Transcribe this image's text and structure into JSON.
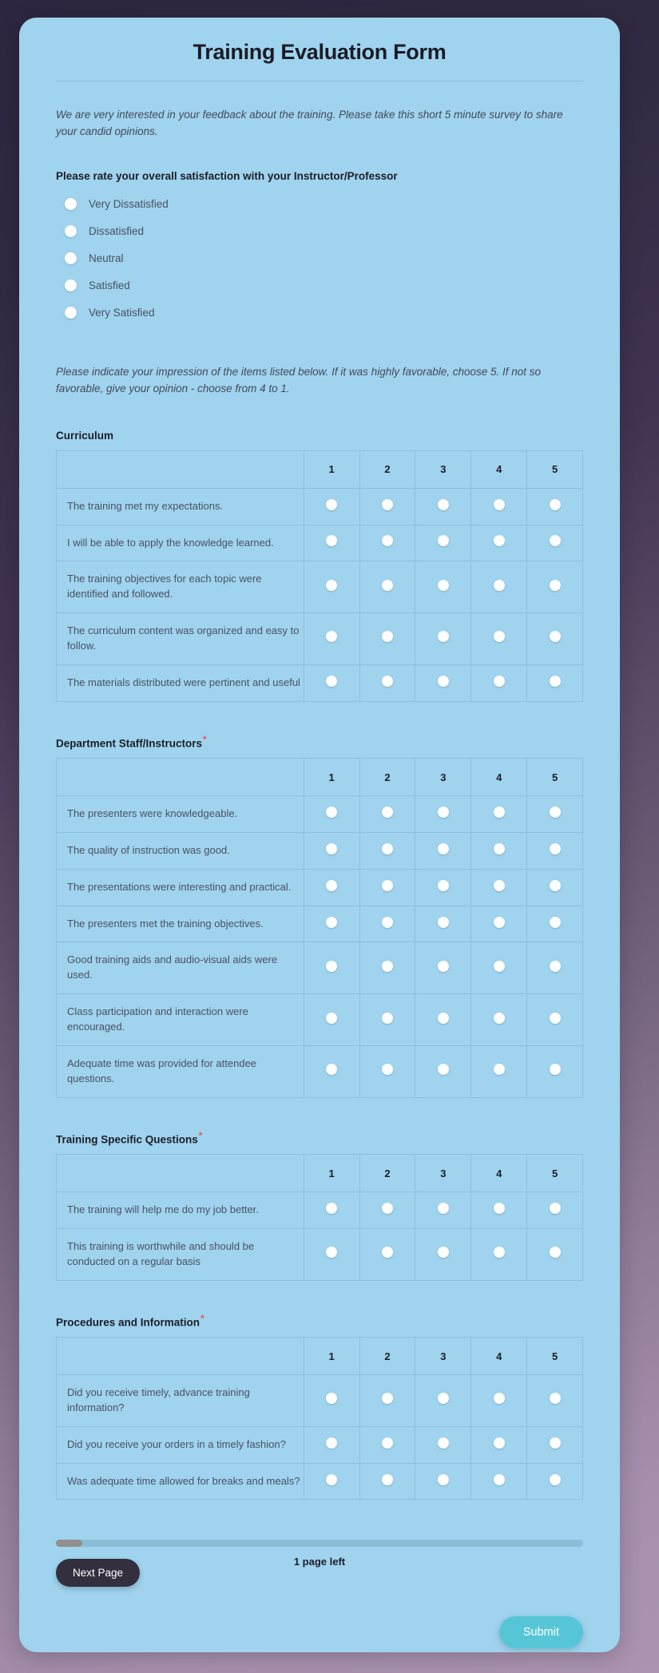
{
  "form": {
    "title": "Training Evaluation Form",
    "intro": "We are very interested in your feedback about the training. Please take this short 5 minute survey to share your candid opinions.",
    "instruction": "Please indicate your impression of the items listed below. If it was highly favorable, choose 5. If not so favorable, give your opinion - choose from 4 to 1.",
    "required_marker": "*"
  },
  "satisfaction_question": {
    "label": "Please rate your overall satisfaction with your Instructor/Professor",
    "options": [
      "Very Dissatisfied",
      "Dissatisfied",
      "Neutral",
      "Satisfied",
      "Very Satisfied"
    ]
  },
  "matrices": [
    {
      "title": "Curriculum",
      "required": false,
      "scale": [
        "1",
        "2",
        "3",
        "4",
        "5"
      ],
      "rows": [
        "The training met my expectations.",
        "I will be able to apply the knowledge learned.",
        "The training objectives for each topic were identified and followed.",
        "The curriculum content was organized and easy to follow.",
        "The materials distributed were pertinent and useful"
      ]
    },
    {
      "title": "Department Staff/Instructors",
      "required": true,
      "scale": [
        "1",
        "2",
        "3",
        "4",
        "5"
      ],
      "rows": [
        "The presenters were knowledgeable.",
        "The quality of instruction was good.",
        "The presentations were interesting and practical.",
        "The presenters met the training objectives.",
        "Good training aids and audio-visual aids were used.",
        "Class participation and interaction were encouraged.",
        "Adequate time was provided for attendee questions."
      ]
    },
    {
      "title": "Training Specific Questions",
      "required": true,
      "scale": [
        "1",
        "2",
        "3",
        "4",
        "5"
      ],
      "rows": [
        "The training will help me do my job better.",
        "This training is worthwhile and should be conducted on a regular basis"
      ]
    },
    {
      "title": "Procedures and Information",
      "required": true,
      "scale": [
        "1",
        "2",
        "3",
        "4",
        "5"
      ],
      "rows": [
        "Did you receive timely, advance training information?",
        "Did you receive your orders in a timely fashion?",
        "Was adequate time allowed for breaks and meals?"
      ]
    }
  ],
  "footer": {
    "progress_percent": 5,
    "pages_left": "1 page left",
    "next_label": "Next Page",
    "submit_label": "Submit"
  },
  "colors": {
    "card_background": "#9fd3ee",
    "accent_submit": "#56c6d6",
    "next_button": "#332f3e",
    "required_star": "#ef5350",
    "progress_fill": "#948e8e",
    "progress_track": "#8bbdd4",
    "table_border": "#8cc2de"
  }
}
